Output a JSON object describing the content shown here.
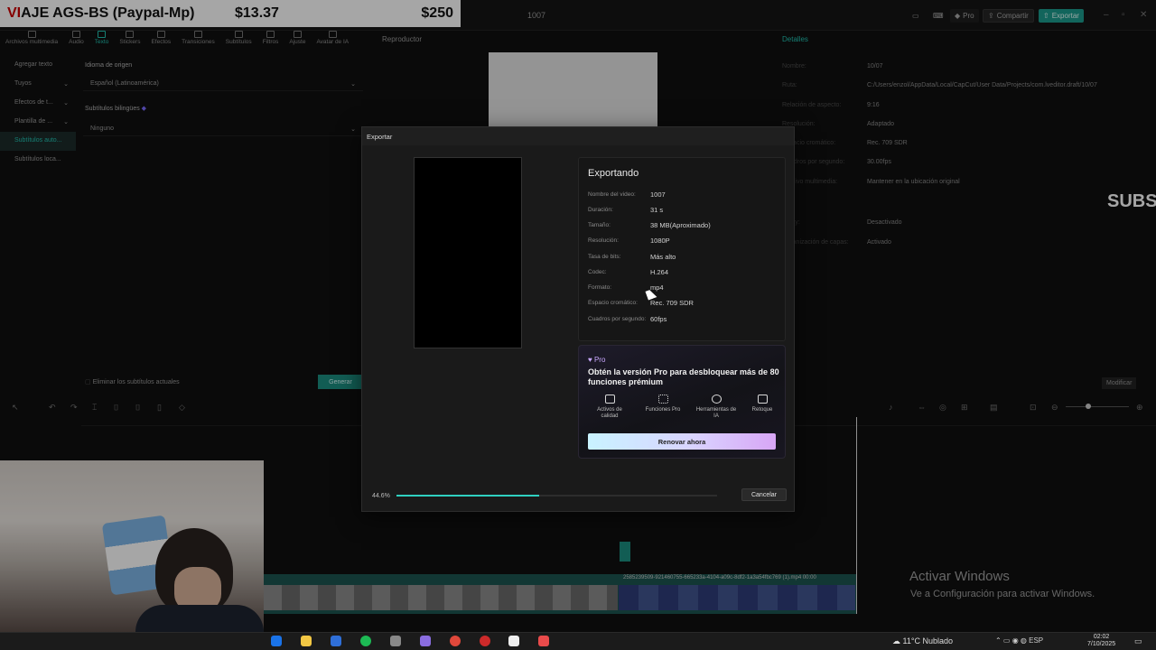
{
  "promo": {
    "title_red": "VI",
    "title_rest": "AJE AGS-BS (Paypal-Mp)",
    "price1": "$13.37",
    "price2": "$250"
  },
  "window": {
    "project_title": "1007",
    "pro": "Pro",
    "share": "Compartir",
    "export": "Exportar"
  },
  "toolbar": {
    "tabs": [
      {
        "label": "Archivos multimedia"
      },
      {
        "label": "Audio"
      },
      {
        "label": "Texto"
      },
      {
        "label": "Stickers"
      },
      {
        "label": "Efectos"
      },
      {
        "label": "Transiciones"
      },
      {
        "label": "Subtítulos"
      },
      {
        "label": "Filtros"
      },
      {
        "label": "Ajuste"
      },
      {
        "label": "Avatar de IA"
      }
    ],
    "active_tab": "Texto"
  },
  "leftnav": {
    "items": [
      {
        "label": "Agregar texto"
      },
      {
        "label": "Tuyos"
      },
      {
        "label": "Efectos de t..."
      },
      {
        "label": "Plantilla de ..."
      },
      {
        "label": "Subtítulos auto..."
      },
      {
        "label": "Subtítulos loca..."
      }
    ]
  },
  "leftpanel": {
    "origin_label": "Idioma de origen",
    "origin_value": "Español (Latinoamérica)",
    "bilingual_label": "Subtítulos bilingües",
    "bilingual_value": "Ninguno",
    "remove_label": "Eliminar los subtítulos actuales",
    "generate": "Generar"
  },
  "player": {
    "label": "Reproductor"
  },
  "details": {
    "label": "Detalles",
    "rows": [
      {
        "key": "Nombre:",
        "value": "10/07"
      },
      {
        "key": "Ruta:",
        "value": "C:/Users/enzol/AppData/Local/CapCut/User Data/Projects/com.lveditor.draft/10/07"
      },
      {
        "key": "Relación de aspecto:",
        "value": "9:16"
      },
      {
        "key": "Resolución:",
        "value": "Adaptado"
      },
      {
        "key": "Espacio cromático:",
        "value": "Rec. 709 SDR"
      },
      {
        "key": "Cuadros por segundo:",
        "value": "30.00fps"
      },
      {
        "key": "Archivo multimedia:",
        "value": "Mantener en la ubicación original"
      },
      {
        "key": "Proxy:",
        "value": "Desactivado"
      },
      {
        "key": "Organización de capas:",
        "value": "Activado"
      }
    ],
    "modify": "Modificar"
  },
  "overlay_text": "SUBS",
  "export_modal": {
    "title": "Exportar",
    "heading": "Exportando",
    "rows": [
      {
        "key": "Nombre del video:",
        "value": "1007"
      },
      {
        "key": "Duración:",
        "value": "31 s"
      },
      {
        "key": "Tamaño:",
        "value": "38 MB(Aproximado)"
      },
      {
        "key": "Resolución:",
        "value": "1080P"
      },
      {
        "key": "Tasa de bits:",
        "value": "Más alto"
      },
      {
        "key": "Codec:",
        "value": "H.264"
      },
      {
        "key": "Formato:",
        "value": "mp4"
      },
      {
        "key": "Espacio cromático:",
        "value": "Rec. 709 SDR"
      },
      {
        "key": "Cuadros por segundo:",
        "value": "60fps"
      }
    ],
    "pro": {
      "badge": "♥ Pro",
      "headline": "Obtén la versión Pro para desbloquear más de 80 funciones prémium",
      "features": [
        {
          "label": "Activos de calidad",
          "icon": "image-icon"
        },
        {
          "label": "Funciones Pro",
          "icon": "grid-icon"
        },
        {
          "label": "Herramientas de IA",
          "icon": "magic-wand-icon"
        },
        {
          "label": "Retoque",
          "icon": "retouch-icon"
        }
      ],
      "renew": "Renovar ahora"
    },
    "progress_text": "44.6%",
    "progress_value": 0.446,
    "cancel": "Cancelar"
  },
  "timeline": {
    "track_name": "2585239509-921460755-665233a-4104-a09c-8df2-1a3a54fbc769 (1).mp4  00:00"
  },
  "windows": {
    "activate_title": "Activar Windows",
    "activate_sub": "Ve a Configuración para activar Windows."
  },
  "taskbar": {
    "weather": "11°C  Nublado",
    "lang": "ESP",
    "time": "02:02",
    "date": "7/10/2025"
  },
  "colors": {
    "accent": "#22c3b2",
    "export_button": "#1d9c8e",
    "progress": "#2fd0c0"
  }
}
